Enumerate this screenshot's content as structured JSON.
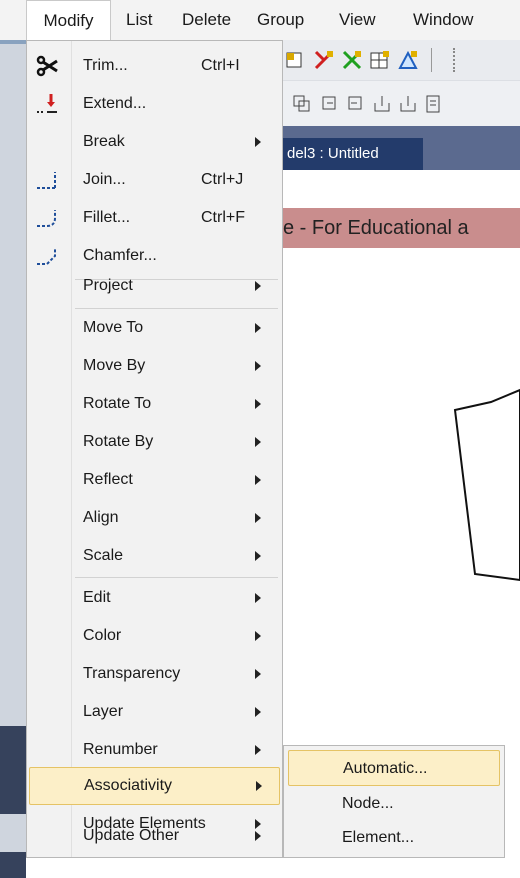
{
  "menubar": {
    "items": [
      "Modify",
      "List",
      "Delete",
      "Group",
      "View",
      "Window"
    ],
    "active": "Modify"
  },
  "document": {
    "tab_title": "del3 : Untitled",
    "banner": "e - For Educational a"
  },
  "modify_menu": {
    "items": [
      {
        "label": "Trim...",
        "shortcut": "Ctrl+I",
        "icon": "trim-icon"
      },
      {
        "label": "Extend...",
        "icon": "extend-icon"
      },
      {
        "label": "Break",
        "submenu": true
      },
      {
        "label": "Join...",
        "shortcut": "Ctrl+J",
        "icon": "join-icon"
      },
      {
        "label": "Fillet...",
        "shortcut": "Ctrl+F",
        "icon": "fillet-icon"
      },
      {
        "label": "Chamfer...",
        "icon": "chamfer-icon"
      },
      {
        "label": "Project",
        "submenu": true
      },
      {
        "label": "Move To",
        "submenu": true
      },
      {
        "label": "Move By",
        "submenu": true
      },
      {
        "label": "Rotate To",
        "submenu": true
      },
      {
        "label": "Rotate By",
        "submenu": true
      },
      {
        "label": "Reflect",
        "submenu": true
      },
      {
        "label": "Align",
        "submenu": true
      },
      {
        "label": "Scale",
        "submenu": true
      },
      {
        "label": "Edit",
        "submenu": true
      },
      {
        "label": "Color",
        "submenu": true
      },
      {
        "label": "Transparency",
        "submenu": true
      },
      {
        "label": "Layer",
        "submenu": true
      },
      {
        "label": "Renumber",
        "submenu": true
      },
      {
        "label": "Associativity",
        "submenu": true,
        "highlighted": true
      },
      {
        "label": "Update Elements",
        "submenu": true
      },
      {
        "label": "Update Other",
        "submenu": true
      }
    ]
  },
  "associativity_submenu": {
    "items": [
      {
        "label": "Automatic...",
        "highlighted": true
      },
      {
        "label": "Node..."
      },
      {
        "label": "Element..."
      }
    ]
  },
  "colors": {
    "highlight_fill": "#fcefc8",
    "highlight_border": "#e5c365",
    "menu_bg": "#f2f2f2",
    "doc_tab": "#233b6b",
    "banner": "#c98d8d"
  }
}
